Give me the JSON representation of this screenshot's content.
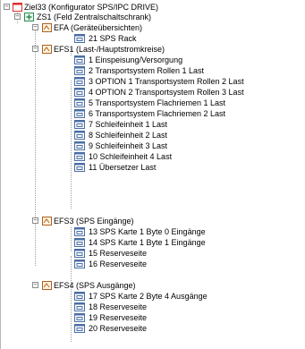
{
  "tree": {
    "root": {
      "label": "Ziel33 (Konfigurator SPS/IPC DRIVE)",
      "expander": "−"
    },
    "zs1": {
      "label": "ZS1 (Feld Zentralschaltschrank)",
      "expander": "−"
    },
    "efa": {
      "label": "EFA (Geräteübersichten)",
      "expander": "−",
      "pages": [
        "21 SPS Rack"
      ]
    },
    "efs1": {
      "label": "EFS1 (Last-/Hauptstromkreise)",
      "expander": "−",
      "pages": [
        "1 Einspeisung/Versorgung",
        "2 Transportsystem Rollen 1 Last",
        "3 OPTION 1 Transportsystem Rollen 2 Last",
        "4 OPTION 2 Transportsystem Rollen 3 Last",
        "5 Transportsystem Flachriemen 1 Last",
        "6 Transportsystem Flachriemen 2 Last",
        "7 Schleifeinheit 1 Last",
        "8 Schleifeinheit 2 Last",
        "9 Schleifeinheit 3 Last",
        "10 Schleifeinheit 4 Last",
        "11 Übersetzer Last"
      ]
    },
    "efs3": {
      "label": "EFS3 (SPS Eingänge)",
      "expander": "−",
      "pages": [
        "13 SPS Karte 1 Byte 0 Eingänge",
        "14 SPS Karte 1 Byte 1 Eingänge",
        "15 Reserveseite",
        "16 Reserveseite"
      ]
    },
    "efs4": {
      "label": "EFS4 (SPS Ausgänge)",
      "expander": "−",
      "pages": [
        "17 SPS Karte 2 Byte 4 Ausgänge",
        "18 Reserveseite",
        "19 Reserveseite",
        "20 Reserveseite"
      ]
    }
  },
  "colors": {
    "selection": "#3399ff",
    "project_icon": "#e03030",
    "cabinet_icon": "#2e8b57",
    "group_icon": "#b06020",
    "page_icon": "#4a6fa5"
  }
}
